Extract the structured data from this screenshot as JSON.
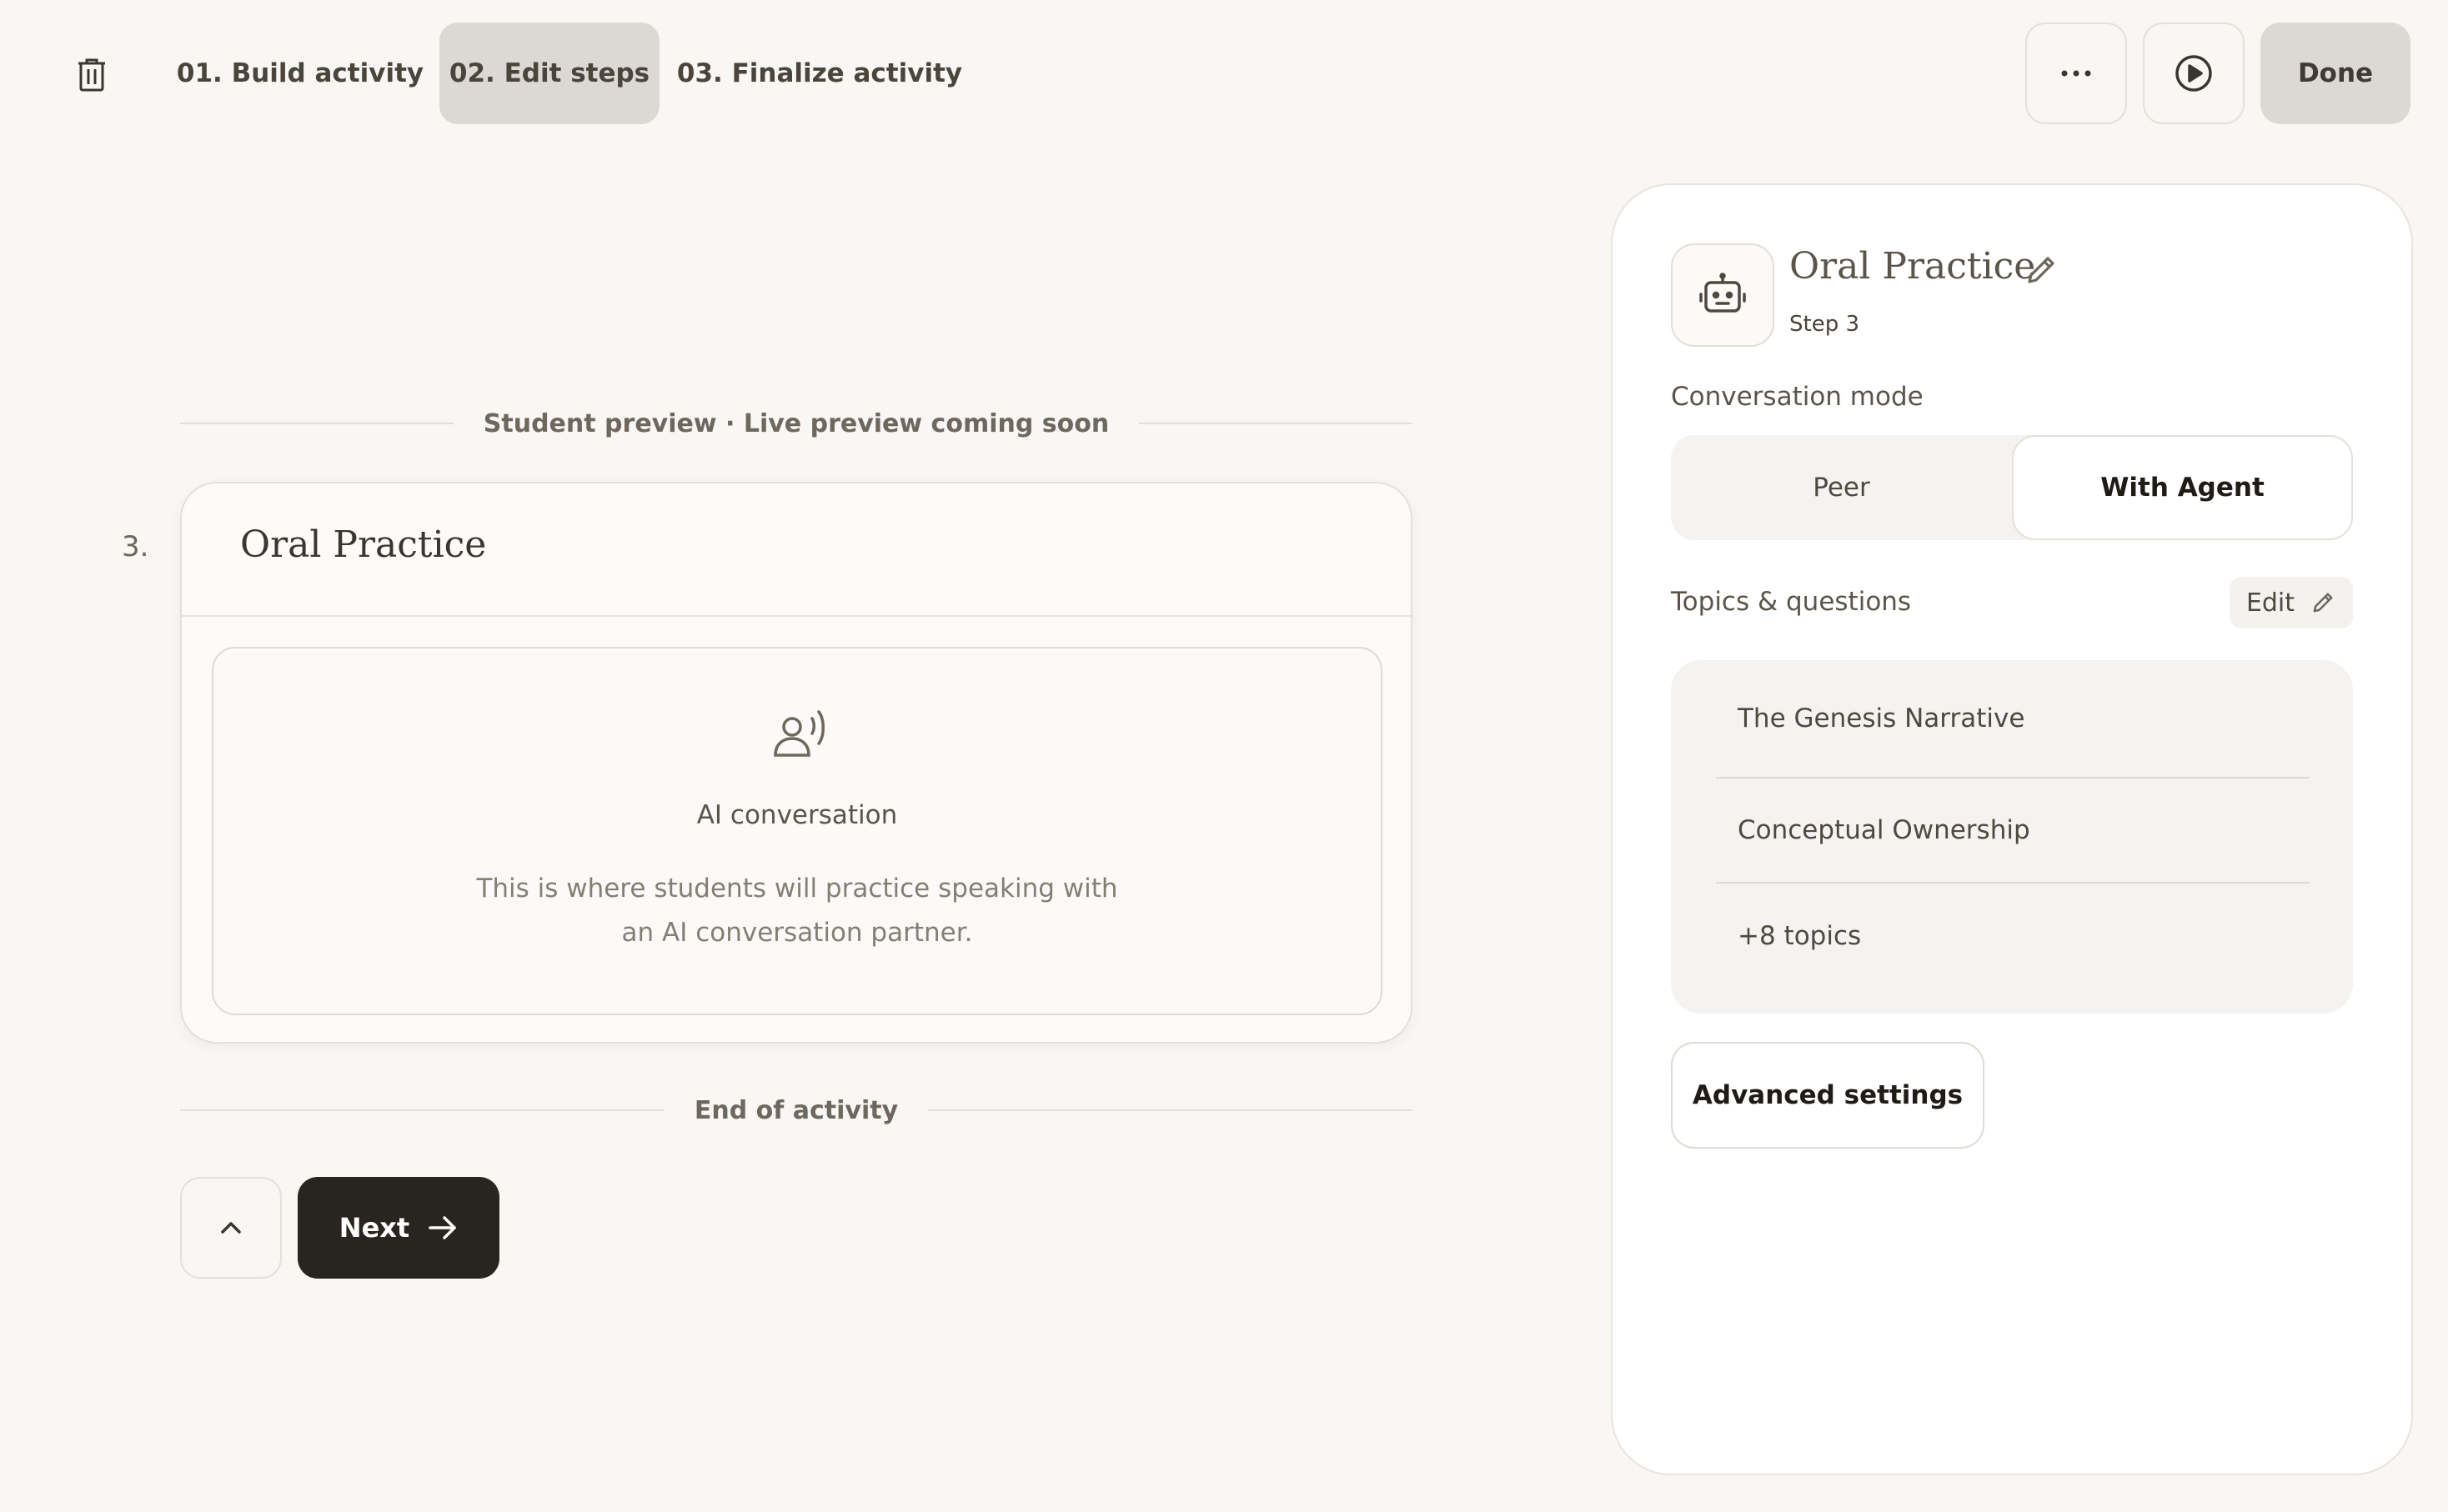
{
  "topbar": {
    "tabs": [
      {
        "label": "01. Build activity"
      },
      {
        "label": "02. Edit steps",
        "active": true
      },
      {
        "label": "03. Finalize activity"
      }
    ],
    "done_label": "Done",
    "icons": {
      "trash": "trash-icon",
      "more": "more-horizontal-icon",
      "play": "play-circle-icon"
    }
  },
  "preview": {
    "header": "Student preview · Live preview coming soon",
    "step_number": "3.",
    "card_title": "Oral Practice",
    "ai_icon": "speaking-person-icon",
    "ai_title": "AI conversation",
    "ai_description": "This is where students will practice speaking with an AI conversation partner.",
    "end_label": "End of activity",
    "next_label": "Next"
  },
  "panel": {
    "avatar_icon": "robot-icon",
    "title": "Oral Practice",
    "subtitle": "Step 3",
    "mode_label": "Conversation mode",
    "modes": [
      {
        "label": "Peer"
      },
      {
        "label": "With Agent",
        "selected": true
      }
    ],
    "topics_label": "Topics & questions",
    "topics_edit_label": "Edit",
    "topics": [
      "The Genesis Narrative",
      "Conceptual Ownership",
      "+8 topics"
    ],
    "advanced_label": "Advanced settings"
  },
  "colors": {
    "background": "#f9f7f4",
    "active_tab": "#dcd9d5",
    "primary_button": "#28241f",
    "panel": "#ffffff"
  }
}
